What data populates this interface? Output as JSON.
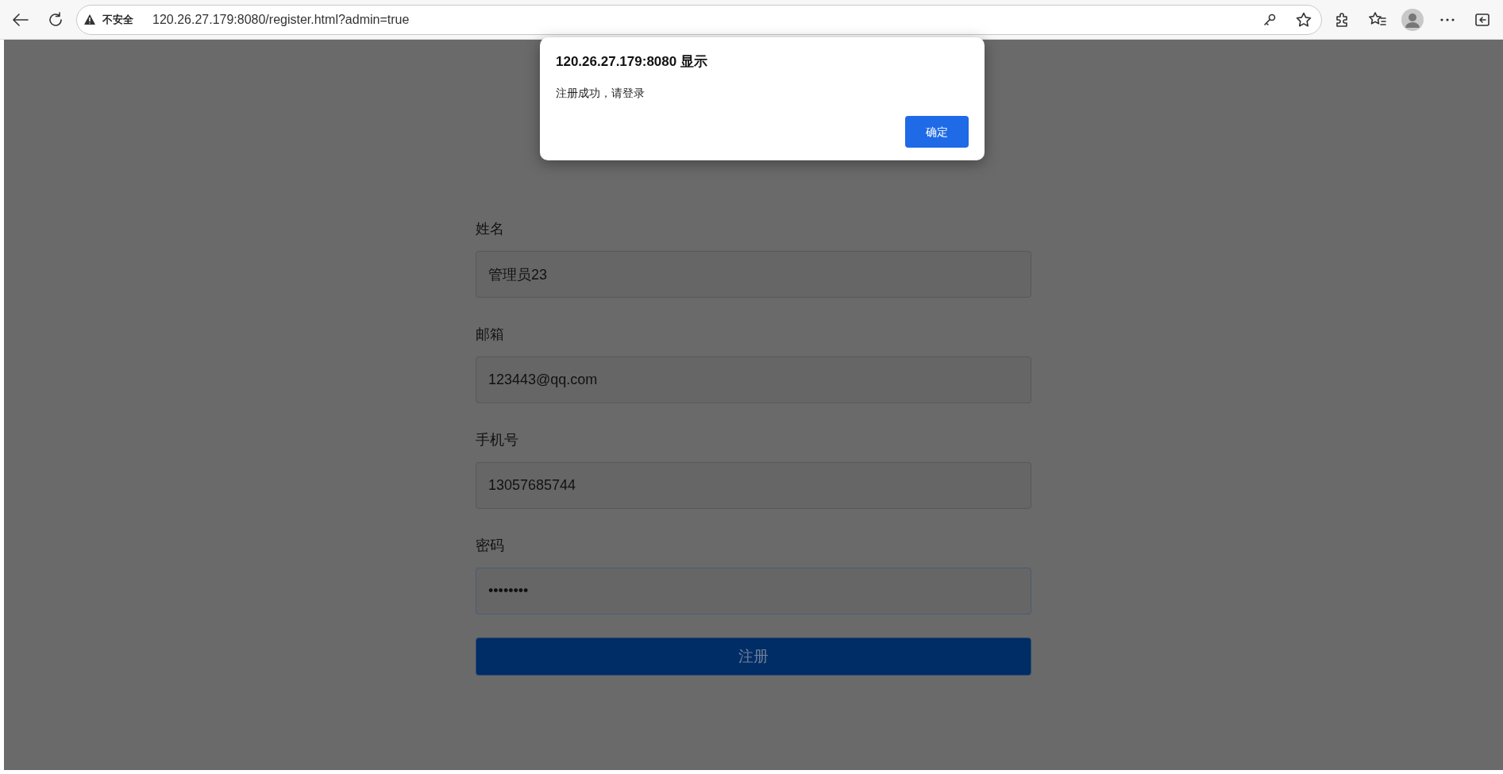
{
  "browser": {
    "security_label": "不安全",
    "url": "120.26.27.179:8080/register.html?admin=true"
  },
  "form": {
    "fields": [
      {
        "label": "姓名",
        "value": "管理员23",
        "focused": false
      },
      {
        "label": "邮箱",
        "value": "123443@qq.com",
        "focused": false
      },
      {
        "label": "手机号",
        "value": "13057685744",
        "focused": false
      },
      {
        "label": "密码",
        "value": "••••••••",
        "focused": true
      }
    ],
    "submit": "注册"
  },
  "dialog": {
    "title": "120.26.27.179:8080 显示",
    "message": "注册成功，请登录",
    "ok": "确定"
  }
}
